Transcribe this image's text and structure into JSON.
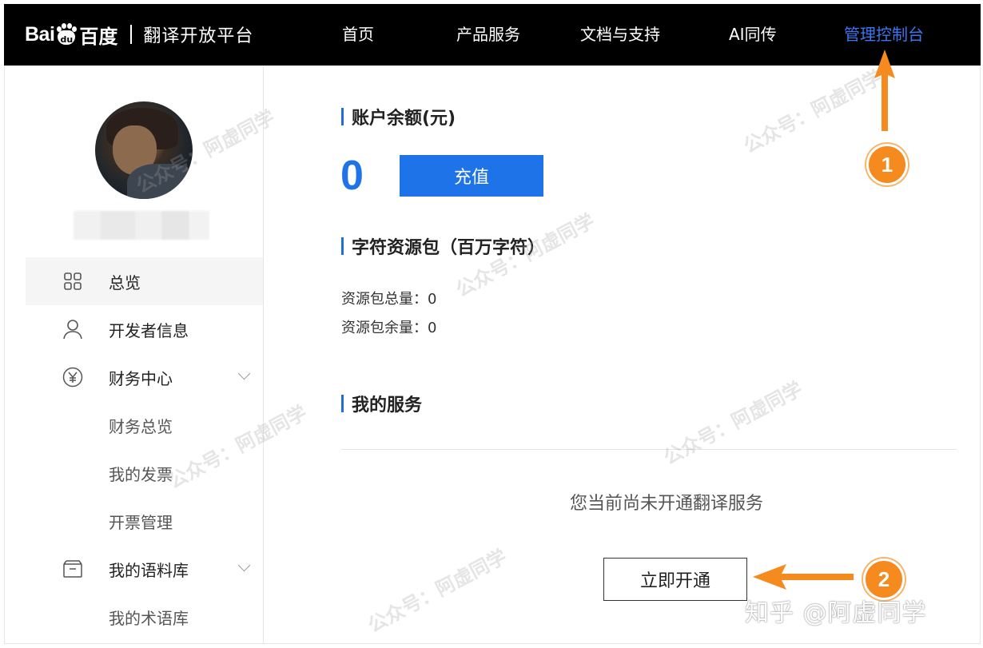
{
  "header": {
    "brand_left": "Bai",
    "brand_paw": "du",
    "brand_cn": "百度",
    "platform": "翻译开放平台",
    "nav": [
      {
        "label": "首页"
      },
      {
        "label": "产品服务"
      },
      {
        "label": "文档与支持"
      },
      {
        "label": "AI同传"
      },
      {
        "label": "管理控制台",
        "active": true
      }
    ]
  },
  "sidebar": {
    "menu": [
      {
        "label": "总览",
        "icon": "grid-icon",
        "active": true
      },
      {
        "label": "开发者信息",
        "icon": "user-icon"
      },
      {
        "label": "财务中心",
        "icon": "yen-circle-icon",
        "expandable": true
      },
      {
        "label": "财务总览",
        "sub": true
      },
      {
        "label": "我的发票",
        "sub": true
      },
      {
        "label": "开票管理",
        "sub": true
      },
      {
        "label": "我的语料库",
        "icon": "inbox-icon",
        "expandable": true
      },
      {
        "label": "我的术语库",
        "sub": true
      }
    ]
  },
  "main": {
    "balance_title": "账户余额(元)",
    "balance_value": "0",
    "recharge_label": "充值",
    "package_title": "字符资源包（百万字符）",
    "package_total_label": "资源包总量：",
    "package_total_value": "0",
    "package_remain_label": "资源包余量：",
    "package_remain_value": "0",
    "services_title": "我的服务",
    "empty_message": "您当前尚未开通翻译服务",
    "activate_label": "立即开通"
  },
  "annotations": {
    "badge_1": "1",
    "badge_2": "2",
    "arrow_color": "#f58a1f"
  },
  "watermark": {
    "text": "公众号：阿虚同学"
  },
  "credit": "知乎 @阿虚同学",
  "colors": {
    "accent": "#1e73e8",
    "nav_active": "#3a76f0",
    "topbar": "#000000"
  }
}
